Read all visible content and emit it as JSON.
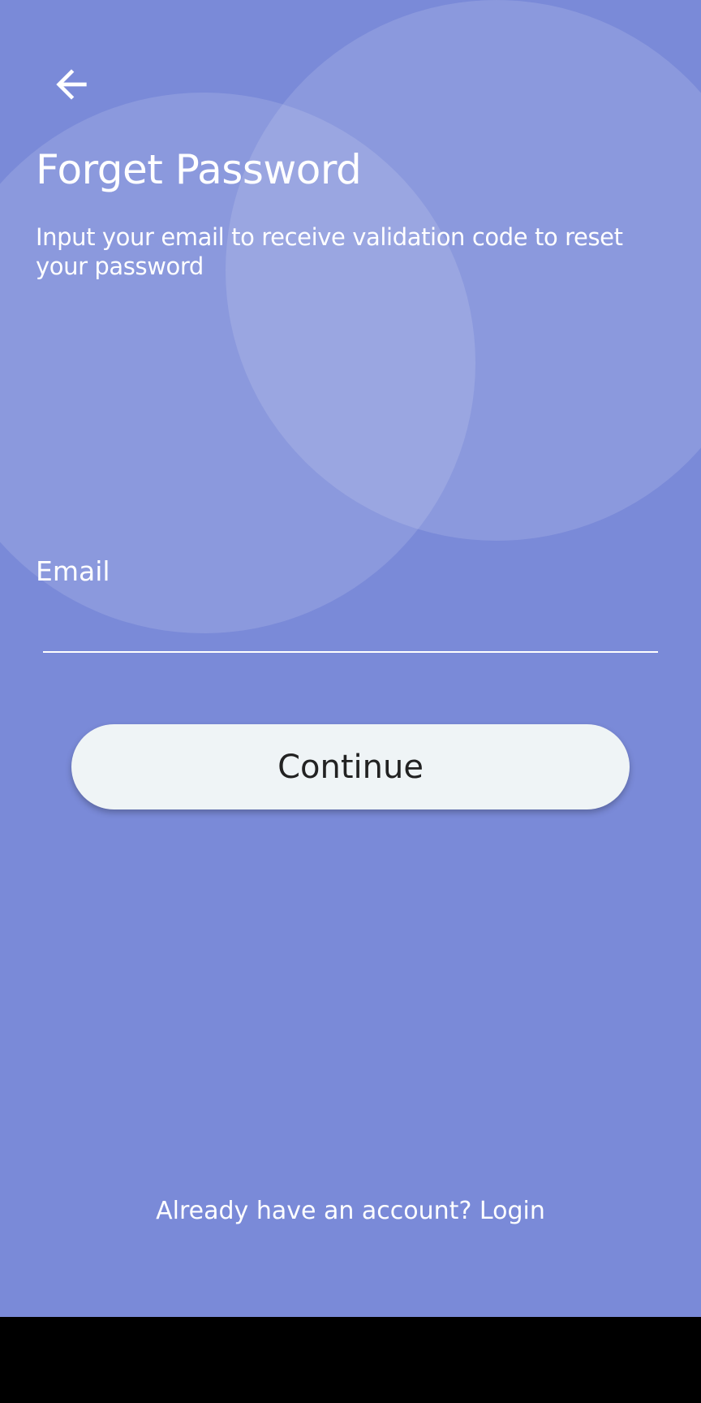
{
  "colors": {
    "background": "#7a8ad8",
    "button_background": "#eff4f6",
    "text_primary": "#ffffff",
    "button_text": "#222222"
  },
  "header": {
    "back_icon": "arrow-left-icon",
    "title": "Forget Password",
    "subtitle": "Input your email to receive validation code to reset your password"
  },
  "form": {
    "email_label": "Email",
    "email_value": "",
    "continue_label": "Continue"
  },
  "footer": {
    "login_prompt": "Already have an account? Login"
  }
}
